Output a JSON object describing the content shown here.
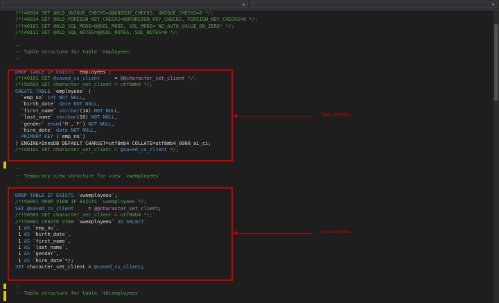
{
  "code_lines": [
    {
      "segs": [
        {
          "t": "/*!40014 SET @OLD_UNIQUE_CHECKS=@@UNIQUE_CHECKS, UNIQUE_CHECKS=0 */;",
          "c": "comment"
        }
      ]
    },
    {
      "segs": [
        {
          "t": "/*!40014 SET @OLD_FOREIGN_KEY_CHECKS=@@FOREIGN_KEY_CHECKS, FOREIGN_KEY_CHECKS=0 */;",
          "c": "comment"
        }
      ]
    },
    {
      "segs": [
        {
          "t": "/*!40101 SET @OLD_SQL_MODE=@@SQL_MODE, SQL_MODE='NO_AUTO_VALUE_ON_ZERO' */;",
          "c": "comment"
        }
      ]
    },
    {
      "segs": [
        {
          "t": "/*!40111 SET @OLD_SQL_NOTES=@@SQL_NOTES, SQL_NOTES=0 */;",
          "c": "comment"
        }
      ]
    },
    {
      "segs": [
        {
          "t": "",
          "c": ""
        }
      ]
    },
    {
      "segs": [
        {
          "t": "--",
          "c": "comment"
        }
      ]
    },
    {
      "segs": [
        {
          "t": "-- Table structure for table `employees`",
          "c": "comment"
        }
      ]
    },
    {
      "segs": [
        {
          "t": "--",
          "c": "comment"
        }
      ]
    },
    {
      "segs": [
        {
          "t": "",
          "c": ""
        }
      ]
    },
    {
      "segs": [
        {
          "t": "DROP TABLE IF EXISTS ",
          "c": "kw"
        },
        {
          "t": "`employees`;",
          "c": ""
        }
      ]
    },
    {
      "segs": [
        {
          "t": "/*!40101 SET ",
          "c": "comment"
        },
        {
          "t": "@saved_cs_client",
          "c": "kw"
        },
        {
          "t": "     = ",
          "c": ""
        },
        {
          "t": "@@character_set_client",
          "c": "var"
        },
        {
          "t": " */;",
          "c": "comment"
        }
      ]
    },
    {
      "segs": [
        {
          "t": "/*!50503 SET character_set_client = utf8mb4 */;",
          "c": "comment"
        }
      ]
    },
    {
      "segs": [
        {
          "t": "CREATE TABLE ",
          "c": "kw"
        },
        {
          "t": "`employees` (",
          "c": ""
        }
      ]
    },
    {
      "segs": [
        {
          "t": "  `emp_no` ",
          "c": ""
        },
        {
          "t": "int NOT NULL",
          "c": "kw"
        },
        {
          "t": ",",
          "c": ""
        }
      ]
    },
    {
      "segs": [
        {
          "t": "  `birth_date` ",
          "c": ""
        },
        {
          "t": "date NOT NULL",
          "c": "kw"
        },
        {
          "t": ",",
          "c": ""
        }
      ]
    },
    {
      "segs": [
        {
          "t": "  `first_name` ",
          "c": ""
        },
        {
          "t": "varchar",
          "c": "kw"
        },
        {
          "t": "(14) ",
          "c": ""
        },
        {
          "t": "NOT NULL",
          "c": "kw"
        },
        {
          "t": ",",
          "c": ""
        }
      ]
    },
    {
      "segs": [
        {
          "t": "  `last_name` ",
          "c": ""
        },
        {
          "t": "varchar",
          "c": "kw"
        },
        {
          "t": "(16) ",
          "c": ""
        },
        {
          "t": "NOT NULL",
          "c": "kw"
        },
        {
          "t": ",",
          "c": ""
        }
      ]
    },
    {
      "segs": [
        {
          "t": "  `gender` ",
          "c": ""
        },
        {
          "t": "enum",
          "c": "kw"
        },
        {
          "t": "(",
          "c": ""
        },
        {
          "t": "'M'",
          "c": "str"
        },
        {
          "t": ",",
          "c": ""
        },
        {
          "t": "'F'",
          "c": "str"
        },
        {
          "t": ") ",
          "c": ""
        },
        {
          "t": "NOT NULL",
          "c": "kw"
        },
        {
          "t": ",",
          "c": ""
        }
      ]
    },
    {
      "segs": [
        {
          "t": "  `hire_date` ",
          "c": ""
        },
        {
          "t": "date NOT NULL",
          "c": "kw"
        },
        {
          "t": ",",
          "c": ""
        }
      ]
    },
    {
      "segs": [
        {
          "t": "  PRIMARY KEY ",
          "c": "kw"
        },
        {
          "t": "(`emp_no`)",
          "c": ""
        }
      ]
    },
    {
      "segs": [
        {
          "t": ") ENGINE=InnoDB DEFAULT CHARSET=utf8mb4 COLLATE=utf8mb4_0900_ai_ci;",
          "c": ""
        }
      ]
    },
    {
      "segs": [
        {
          "t": "/*!40101 SET character_set_client = ",
          "c": "comment"
        },
        {
          "t": "@saved_cs_client",
          "c": "kw"
        },
        {
          "t": " */;",
          "c": "comment"
        }
      ]
    },
    {
      "segs": [
        {
          "t": "",
          "c": ""
        }
      ]
    },
    {
      "segs": [
        {
          "t": "",
          "c": ""
        }
      ]
    },
    {
      "segs": [
        {
          "t": "--",
          "c": "comment"
        }
      ]
    },
    {
      "segs": [
        {
          "t": "-- Temporary view structure for view `vwemployees`",
          "c": "comment"
        }
      ]
    },
    {
      "segs": [
        {
          "t": "--",
          "c": "comment"
        }
      ]
    },
    {
      "segs": [
        {
          "t": "",
          "c": ""
        }
      ]
    },
    {
      "segs": [
        {
          "t": "DROP TABLE IF EXISTS ",
          "c": "kw"
        },
        {
          "t": "`vwemployees`;",
          "c": ""
        }
      ]
    },
    {
      "segs": [
        {
          "t": "/*!50001 DROP VIEW IF EXISTS `vwemployees`*/;",
          "c": "comment"
        }
      ]
    },
    {
      "segs": [
        {
          "t": "SET ",
          "c": "kw"
        },
        {
          "t": "@saved_cs_client",
          "c": "kw"
        },
        {
          "t": "     = ",
          "c": ""
        },
        {
          "t": "@@character_set_client",
          "c": "var"
        },
        {
          "t": ";",
          "c": ""
        }
      ]
    },
    {
      "segs": [
        {
          "t": "/*!50503 SET character_set_client = utf8mb4 */;",
          "c": "comment"
        }
      ]
    },
    {
      "segs": [
        {
          "t": "/*!50001 CREATE VIEW ",
          "c": "comment"
        },
        {
          "t": "`vwemployees`",
          "c": ""
        },
        {
          "t": " AS SELECT",
          "c": "kw"
        }
      ]
    },
    {
      "segs": [
        {
          "t": " 1 ",
          "c": ""
        },
        {
          "t": "AS ",
          "c": "kw"
        },
        {
          "t": "`emp_no`,",
          "c": ""
        }
      ]
    },
    {
      "segs": [
        {
          "t": " 1 ",
          "c": ""
        },
        {
          "t": "AS ",
          "c": "kw"
        },
        {
          "t": "`birth_date`,",
          "c": ""
        }
      ]
    },
    {
      "segs": [
        {
          "t": " 1 ",
          "c": ""
        },
        {
          "t": "AS ",
          "c": "kw"
        },
        {
          "t": "`first_name`,",
          "c": ""
        }
      ]
    },
    {
      "segs": [
        {
          "t": " 1 ",
          "c": ""
        },
        {
          "t": "AS ",
          "c": "kw"
        },
        {
          "t": "`last_name`,",
          "c": ""
        }
      ]
    },
    {
      "segs": [
        {
          "t": " 1 ",
          "c": ""
        },
        {
          "t": "AS ",
          "c": "kw"
        },
        {
          "t": "`gender`,",
          "c": ""
        }
      ]
    },
    {
      "segs": [
        {
          "t": " 1 ",
          "c": ""
        },
        {
          "t": "AS ",
          "c": "kw"
        },
        {
          "t": "`hire_date`*/;",
          "c": ""
        }
      ]
    },
    {
      "segs": [
        {
          "t": "SET ",
          "c": "kw"
        },
        {
          "t": "character_set_client = ",
          "c": ""
        },
        {
          "t": "@saved_cs_client",
          "c": "kw"
        },
        {
          "t": ";",
          "c": ""
        }
      ]
    },
    {
      "segs": [
        {
          "t": "",
          "c": ""
        }
      ]
    },
    {
      "segs": [
        {
          "t": "",
          "c": ""
        }
      ]
    },
    {
      "segs": [
        {
          "t": "--",
          "c": "comment"
        }
      ]
    },
    {
      "segs": [
        {
          "t": "-- Table structure for table `tblemployees`",
          "c": "comment"
        }
      ]
    }
  ],
  "annotations": {
    "table_definition": "Table definition",
    "view_definition": "View definition"
  },
  "colors": {
    "annotation": "#c80000",
    "background": "#1e1e1e",
    "comment": "#57a64a",
    "keyword": "#569cd6"
  }
}
